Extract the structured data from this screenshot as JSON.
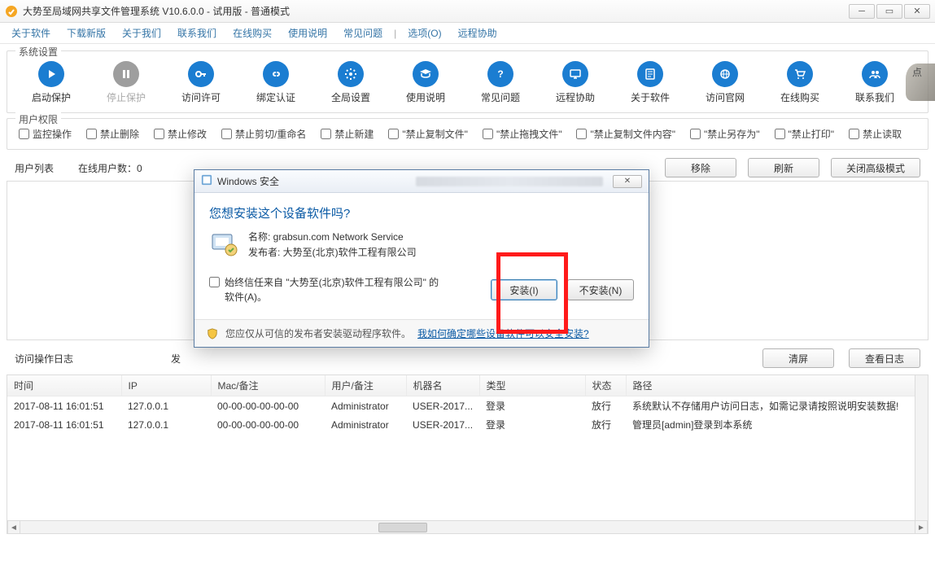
{
  "window": {
    "title": "大势至局域网共享文件管理系统 V10.6.0.0 - 试用版 - 普通模式"
  },
  "menu": [
    "关于软件",
    "下载新版",
    "关于我们",
    "联系我们",
    "在线购买",
    "使用说明",
    "常见问题",
    "",
    "选项(O)",
    "远程协助"
  ],
  "toolbar_section_title": "系统设置",
  "toolbar": [
    {
      "label": "启动保护",
      "color": "#1b7dd1",
      "glyph": "play"
    },
    {
      "label": "停止保护",
      "color": "#9e9e9e",
      "glyph": "pause",
      "disabled": true
    },
    {
      "label": "访问许可",
      "color": "#1b7dd1",
      "glyph": "key"
    },
    {
      "label": "绑定认证",
      "color": "#1b7dd1",
      "glyph": "link"
    },
    {
      "label": "全局设置",
      "color": "#1b7dd1",
      "glyph": "gear"
    },
    {
      "label": "使用说明",
      "color": "#1b7dd1",
      "glyph": "grad"
    },
    {
      "label": "常见问题",
      "color": "#1b7dd1",
      "glyph": "question"
    },
    {
      "label": "远程协助",
      "color": "#1b7dd1",
      "glyph": "screen"
    },
    {
      "label": "关于软件",
      "color": "#1b7dd1",
      "glyph": "info"
    },
    {
      "label": "访问官网",
      "color": "#1b7dd1",
      "glyph": "ie"
    },
    {
      "label": "在线购买",
      "color": "#1b7dd1",
      "glyph": "cart"
    },
    {
      "label": "联系我们",
      "color": "#1b7dd1",
      "glyph": "people"
    }
  ],
  "perm_section_title": "用户权限",
  "permissions": [
    "监控操作",
    "禁止删除",
    "禁止修改",
    "禁止剪切/重命名",
    "禁止新建",
    "\"禁止复制文件\"",
    "\"禁止拖拽文件\"",
    "\"禁止复制文件内容\"",
    "\"禁止另存为\"",
    "\"禁止打印\"",
    "禁止读取"
  ],
  "userlist": {
    "label": "用户列表",
    "online_label": "在线用户数：",
    "online_count": "0",
    "btn_remove": "移除",
    "btn_refresh": "刷新",
    "btn_close_adv": "关闭高级模式"
  },
  "log": {
    "header_left": "访问操作日志",
    "header_mid": "发",
    "btn_clear": "清屏",
    "btn_view": "查看日志",
    "columns": [
      "时间",
      "IP",
      "Mac/备注",
      "用户/备注",
      "机器名",
      "类型",
      "状态",
      "路径"
    ],
    "rows": [
      {
        "time": "2017-08-11 16:01:51",
        "ip": "127.0.0.1",
        "mac": "00-00-00-00-00-00",
        "user": "Administrator",
        "host": "USER-2017...",
        "type": "登录",
        "status": "放行",
        "path": "系统默认不存储用户访问日志，如需记录请按照说明安装数据!"
      },
      {
        "time": "2017-08-11 16:01:51",
        "ip": "127.0.0.1",
        "mac": "00-00-00-00-00-00",
        "user": "Administrator",
        "host": "USER-2017...",
        "type": "登录",
        "status": "放行",
        "path": "管理员[admin]登录到本系统"
      }
    ]
  },
  "dialog": {
    "title": "Windows 安全",
    "heading": "您想安装这个设备软件吗?",
    "name_label": "名称: grabsun.com Network Service",
    "publisher_label": "发布者: 大势至(北京)软件工程有限公司",
    "always_trust": "始终信任来自 \"大势至(北京)软件工程有限公司\" 的软件(A)。",
    "btn_install": "安装(I)",
    "btn_no_install": "不安装(N)",
    "footer_text": "您应仅从可信的发布者安装驱动程序软件。",
    "footer_link": "我如何确定哪些设备软件可以安全安装?"
  },
  "rock_label": "点"
}
